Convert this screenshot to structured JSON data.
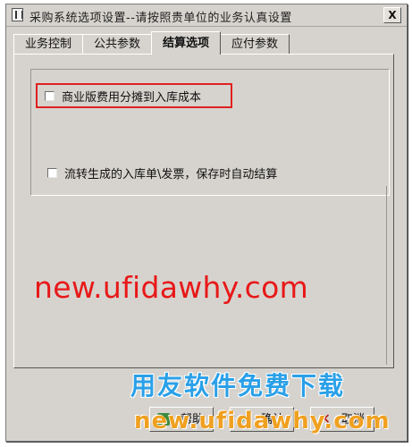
{
  "window": {
    "title": "采购系统选项设置--请按照贵单位的业务认真设置",
    "close_label": "X"
  },
  "tabs": [
    {
      "label": "业务控制",
      "active": false
    },
    {
      "label": "公共参数",
      "active": false
    },
    {
      "label": "结算选项",
      "active": true
    },
    {
      "label": "应付参数",
      "active": false
    }
  ],
  "options": [
    {
      "label": "商业版费用分摊到入库成本",
      "checked": false,
      "highlighted": true
    },
    {
      "label": "流转生成的入库单\\发票，保存时自动结算",
      "checked": false,
      "highlighted": false
    }
  ],
  "buttons": {
    "help": "帮助",
    "ok": "确认",
    "cancel": "取消"
  },
  "watermark": {
    "url": "new.ufidawhy.com",
    "promo_title": "用友软件免费下载",
    "promo_url": "new.ufidawhy.com"
  },
  "colors": {
    "dialog_bg": "#d6d3ce",
    "highlight_border": "#e02020",
    "watermark_red": "#e81818",
    "promo_blue": "#2aa0e8",
    "promo_orange": "#f0a020"
  }
}
